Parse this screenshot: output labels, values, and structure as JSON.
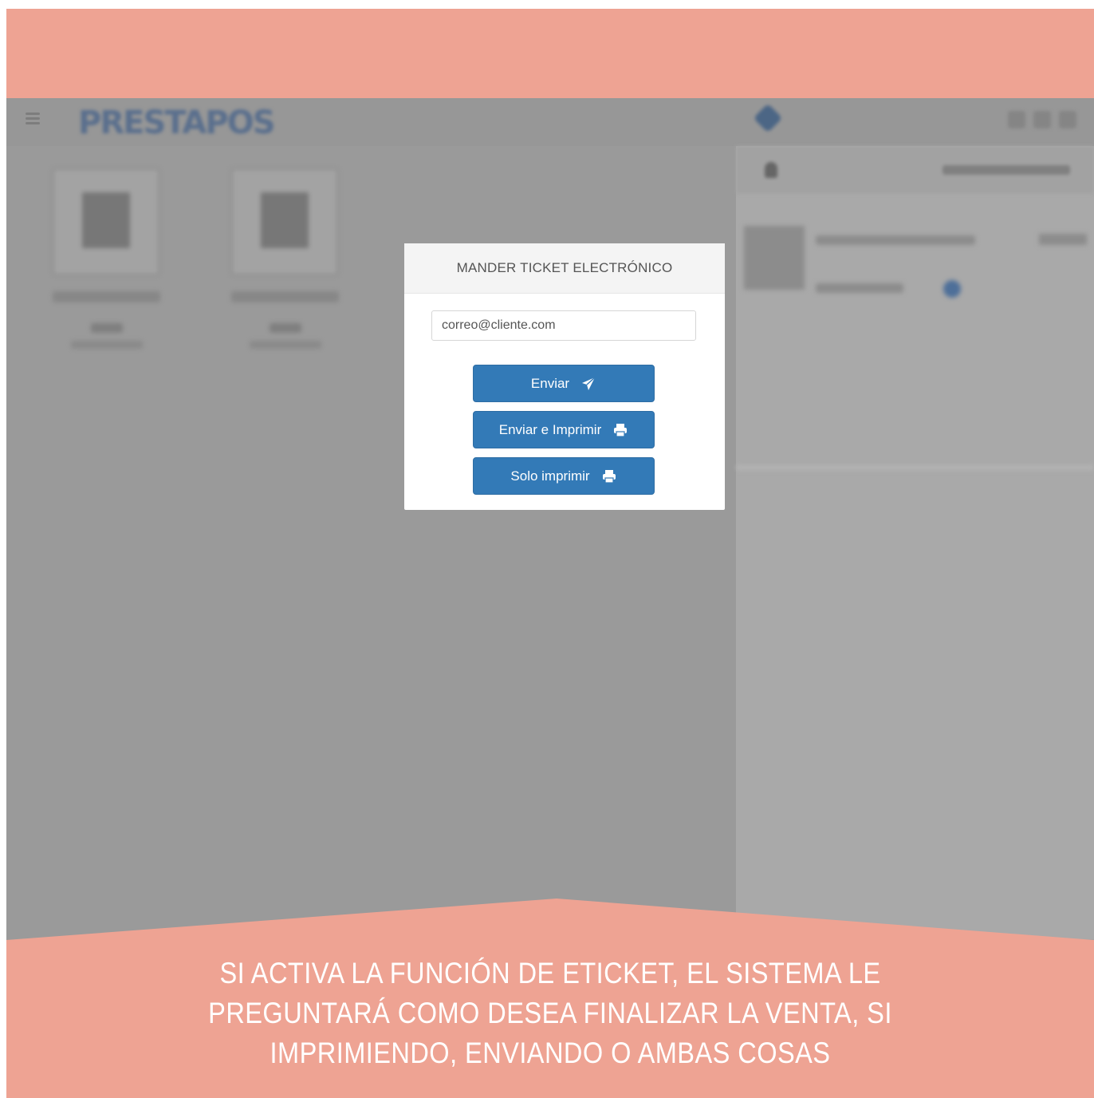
{
  "modal": {
    "title": "MANDER TICKET ELECTRÓNICO",
    "email_value": "correo@cliente.com",
    "buttons": {
      "send": {
        "label": "Enviar",
        "icon": "paper-plane-icon"
      },
      "send_print": {
        "label": "Enviar e Imprimir",
        "icon": "printer-icon"
      },
      "print_only": {
        "label": "Solo imprimir",
        "icon": "printer-icon"
      }
    },
    "accent_color": "#337ab7"
  },
  "caption": {
    "lines": [
      "SI ACTIVA LA FUNCIÓN DE ETICKET, EL SISTEMA LE",
      "PREGUNTARÁ COMO DESEA FINALIZAR LA VENTA, SI",
      "IMPRIMIENDO, ENVIANDO O AMBAS COSAS"
    ]
  },
  "colors": {
    "banner": "#eea393",
    "overlay": "#9a9a9a",
    "button": "#337ab7"
  }
}
